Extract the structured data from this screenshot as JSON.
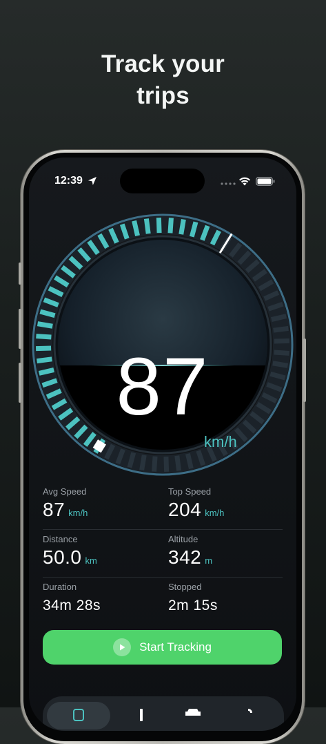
{
  "headline": {
    "line1": "Track your",
    "line2": "trips"
  },
  "status_bar": {
    "time": "12:39"
  },
  "speedometer": {
    "speed": "87",
    "unit": "km/h",
    "progress_fraction": 0.5,
    "accent_color": "#4cc2c0"
  },
  "stats": {
    "avg_speed": {
      "label": "Avg Speed",
      "value": "87",
      "unit": "km/h"
    },
    "top_speed": {
      "label": "Top Speed",
      "value": "204",
      "unit": "km/h"
    },
    "distance": {
      "label": "Distance",
      "value": "50.0",
      "unit": "km"
    },
    "altitude": {
      "label": "Altitude",
      "value": "342",
      "unit": "m"
    },
    "duration": {
      "label": "Duration",
      "value": "34m 28s"
    },
    "stopped": {
      "label": "Stopped",
      "value": "2m 15s"
    }
  },
  "start_button": {
    "label": "Start Tracking",
    "color": "#4fd36b"
  },
  "tab_bar": {
    "tabs": [
      {
        "icon": "speedometer-icon",
        "active": true
      },
      {
        "icon": "chart-icon",
        "active": false
      },
      {
        "icon": "car-icon",
        "active": false
      },
      {
        "icon": "settings-icon",
        "active": false
      }
    ]
  }
}
